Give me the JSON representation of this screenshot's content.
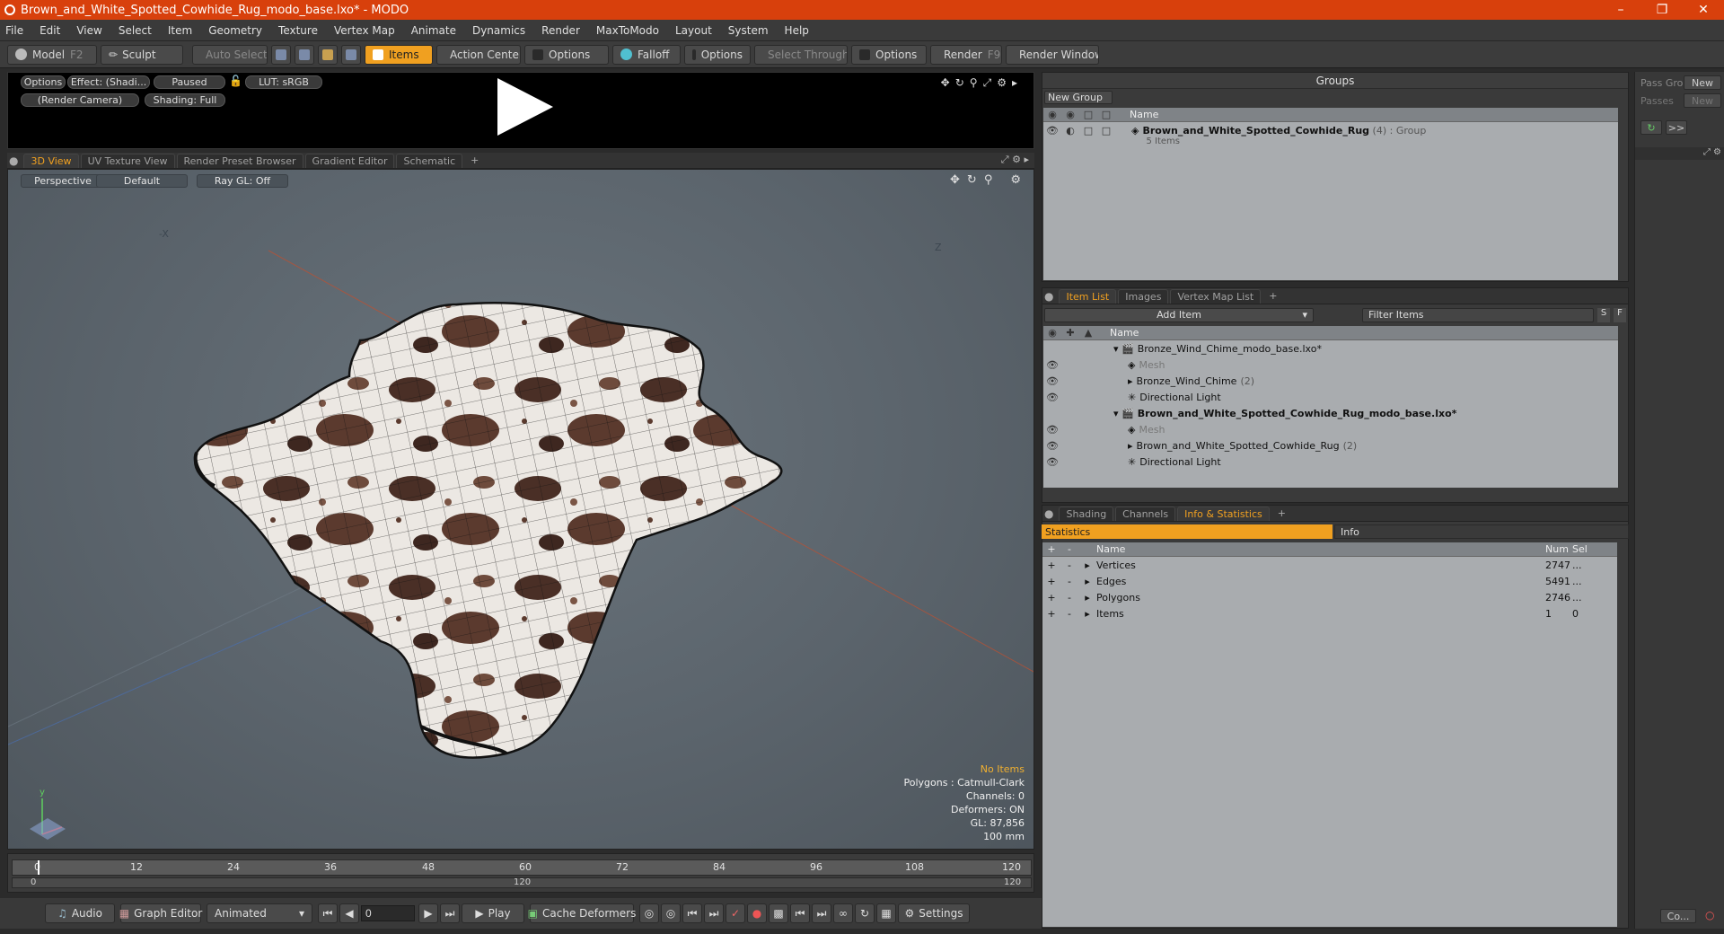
{
  "window": {
    "title": "Brown_and_White_Spotted_Cowhide_Rug_modo_base.lxo* - MODO"
  },
  "menu": [
    "File",
    "Edit",
    "View",
    "Select",
    "Item",
    "Geometry",
    "Texture",
    "Vertex Map",
    "Animate",
    "Dynamics",
    "Render",
    "MaxToModo",
    "Layout",
    "System",
    "Help"
  ],
  "toolbar": {
    "model": "Model",
    "model_key": "F2",
    "sculpt": "Sculpt",
    "auto_select": "Auto Select",
    "items": "Items",
    "action_center": "Action Center",
    "options1": "Options",
    "falloff": "Falloff",
    "options2": "Options",
    "select_through": "Select Through",
    "options3": "Options",
    "render": "Render",
    "render_key": "F9",
    "render_window": "Render Window"
  },
  "preview": {
    "options": "Options",
    "effect": "Effect: (Shadi...",
    "paused": "Paused",
    "lut": "LUT: sRGB",
    "camera": "(Render Camera)",
    "shading": "Shading: Full"
  },
  "viewtabs": [
    "3D View",
    "UV Texture View",
    "Render Preset Browser",
    "Gradient Editor",
    "Schematic",
    "+"
  ],
  "viewport": {
    "perspective": "Perspective",
    "default": "Default",
    "raygl": "Ray GL: Off",
    "axis_neg_x": "-X",
    "axis_z": "Z"
  },
  "vpinfo": {
    "no_items": "No Items",
    "polygons": "Polygons : Catmull-Clark",
    "channels": "Channels: 0",
    "deformers": "Deformers: ON",
    "gl": "GL: 87,856",
    "scale": "100 mm"
  },
  "timeline": {
    "ticks": [
      "0",
      "12",
      "24",
      "36",
      "48",
      "60",
      "72",
      "84",
      "96",
      "108",
      "120"
    ],
    "range_start": "0",
    "range_mid": "120",
    "range_end": "120"
  },
  "bottom": {
    "audio": "Audio",
    "graph_editor": "Graph Editor",
    "animated": "Animated",
    "frame": "0",
    "play": "Play",
    "cache": "Cache Deformers",
    "settings": "Settings"
  },
  "groups": {
    "title": "Groups",
    "new_group": "New Group",
    "col_name": "Name",
    "item_name": "Brown_and_White_Spotted_Cowhide_Rug",
    "item_count": "(4)",
    "item_type": ": Group",
    "item_sub": "5 Items"
  },
  "itemlist": {
    "tabs": [
      "Item List",
      "Images",
      "Vertex Map List",
      "+"
    ],
    "add_item": "Add Item",
    "filter": "Filter Items",
    "s": "S",
    "f": "F",
    "col_name": "Name",
    "rows": [
      {
        "name": "Bronze_Wind_Chime_modo_base.lxo*",
        "indent": 0,
        "type": "scene"
      },
      {
        "name": "Mesh",
        "indent": 1,
        "type": "mesh"
      },
      {
        "name": "Bronze_Wind_Chime",
        "extra": "(2)",
        "indent": 1,
        "type": "group"
      },
      {
        "name": "Directional Light",
        "indent": 1,
        "type": "light"
      },
      {
        "name": "Brown_and_White_Spotted_Cowhide_Rug_modo_base.lxo*",
        "indent": 0,
        "type": "scene",
        "bold": true
      },
      {
        "name": "Mesh",
        "indent": 1,
        "type": "mesh"
      },
      {
        "name": "Brown_and_White_Spotted_Cowhide_Rug",
        "extra": "(2)",
        "indent": 1,
        "type": "group"
      },
      {
        "name": "Directional Light",
        "indent": 1,
        "type": "light"
      }
    ]
  },
  "stats": {
    "tabs": [
      "Shading",
      "Channels",
      "Info & Statistics",
      "+"
    ],
    "statistics": "Statistics",
    "info": "Info",
    "col_name": "Name",
    "col_num": "Num",
    "col_sel": "Sel",
    "rows": [
      {
        "name": "Vertices",
        "num": "2747",
        "sel": "..."
      },
      {
        "name": "Edges",
        "num": "5491",
        "sel": "..."
      },
      {
        "name": "Polygons",
        "num": "2746",
        "sel": "..."
      },
      {
        "name": "Items",
        "num": "1",
        "sel": "0"
      }
    ]
  },
  "far": {
    "pass_group": "Pass Gro",
    "passes": "Passes",
    "new1": "New",
    "new2": "New",
    "arrows": ">>",
    "co": "Co..."
  }
}
